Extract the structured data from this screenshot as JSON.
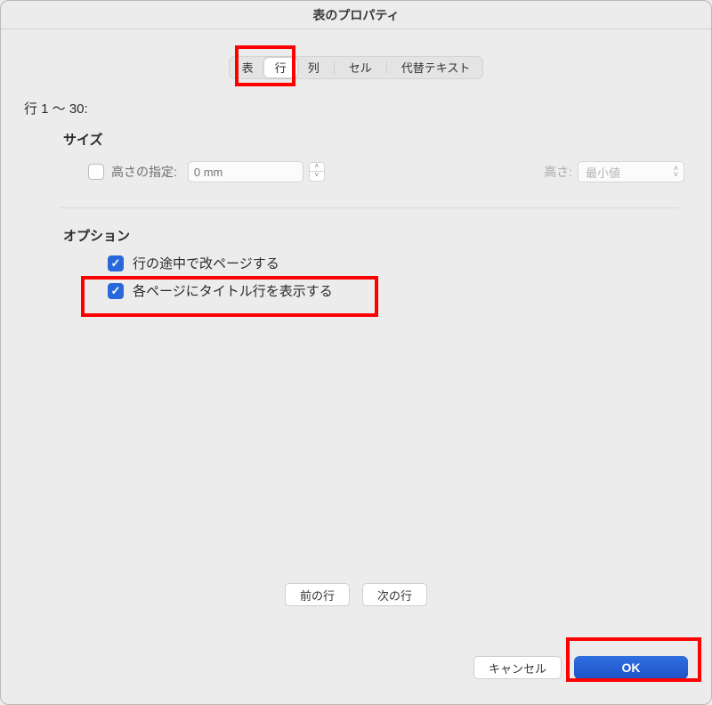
{
  "title": "表のプロパティ",
  "tabs": [
    "表",
    "行",
    "列",
    "セル",
    "代替テキスト"
  ],
  "active_tab_index": 1,
  "row_range_label": "行 1 〜 30:",
  "size": {
    "title": "サイズ",
    "specify_height_label": "高さの指定:",
    "specify_height_checked": false,
    "height_input_placeholder": "0 mm",
    "height_mode_label": "高さ:",
    "height_mode_value": "最小値"
  },
  "options": {
    "title": "オプション",
    "break_row_label": "行の途中で改ページする",
    "break_row_checked": true,
    "repeat_header_label": "各ページにタイトル行を表示する",
    "repeat_header_checked": true
  },
  "nav": {
    "prev": "前の行",
    "next": "次の行"
  },
  "footer": {
    "cancel": "キャンセル",
    "ok": "OK"
  }
}
